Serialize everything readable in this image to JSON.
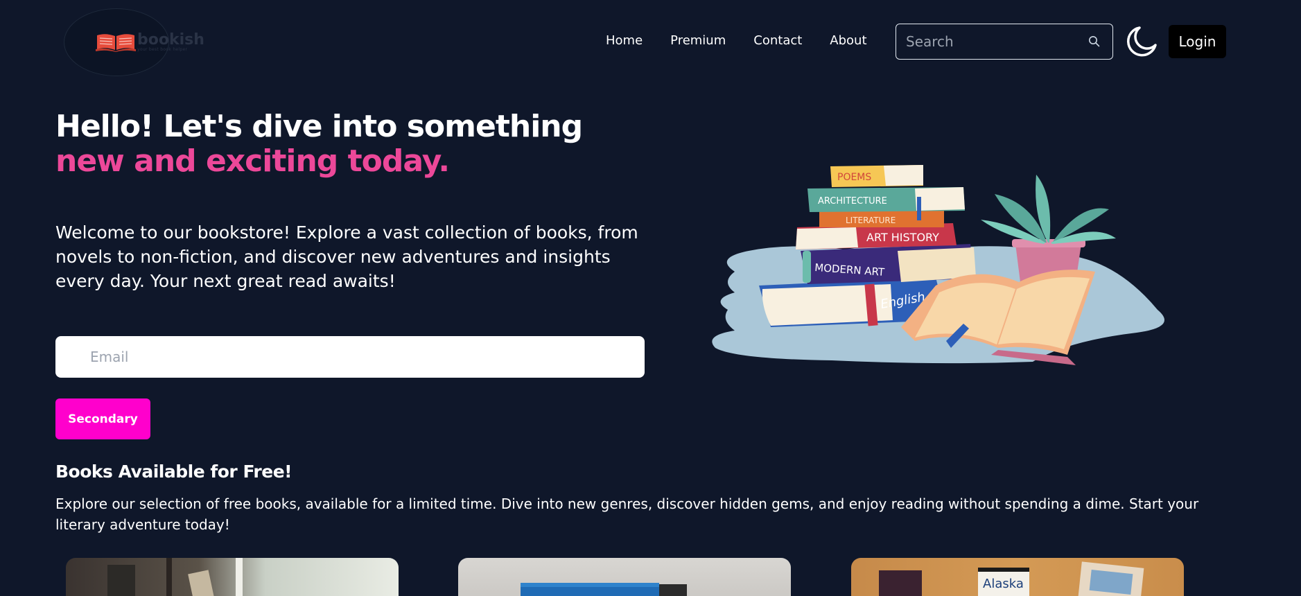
{
  "brand": {
    "name": "bookish",
    "tagline": "your best book helper",
    "logo_color": "#e74c3c"
  },
  "nav": {
    "items": [
      "Home",
      "Premium",
      "Contact",
      "About"
    ]
  },
  "search": {
    "placeholder": "Search",
    "icon": "search-icon"
  },
  "header": {
    "theme_icon": "moon-icon",
    "login_label": "Login"
  },
  "hero": {
    "title_plain": "Hello! Let's dive into something ",
    "title_accent": "new and exciting today.",
    "description": "Welcome to our bookstore! Explore a vast collection of books, from novels to non-fiction, and discover new adventures and insights every day. Your next great read awaits!",
    "email_placeholder": "Email",
    "secondary_label": "Secondary",
    "illustration": {
      "book_labels": [
        "POEMS",
        "ARCHITECTURE",
        "LITERATURE",
        "ART HISTORY",
        "MODERN ART",
        "English"
      ]
    }
  },
  "free_books": {
    "title": "Books Available for Free!",
    "description": "Explore our selection of free books, available for a limited time. Dive into new genres, discover hidden gems, and enjoy reading without spending a dime. Start your literary adventure today!",
    "cards": [
      {
        "image": "window-with-books-photo"
      },
      {
        "image": "blue-book-photo"
      },
      {
        "image": "travel-guides-photo",
        "visible_text": "Alaska"
      }
    ]
  },
  "colors": {
    "background": "#0f172a",
    "accent_pink": "#ec4899",
    "secondary_button": "#ff00cc",
    "login_bg": "#000000"
  }
}
